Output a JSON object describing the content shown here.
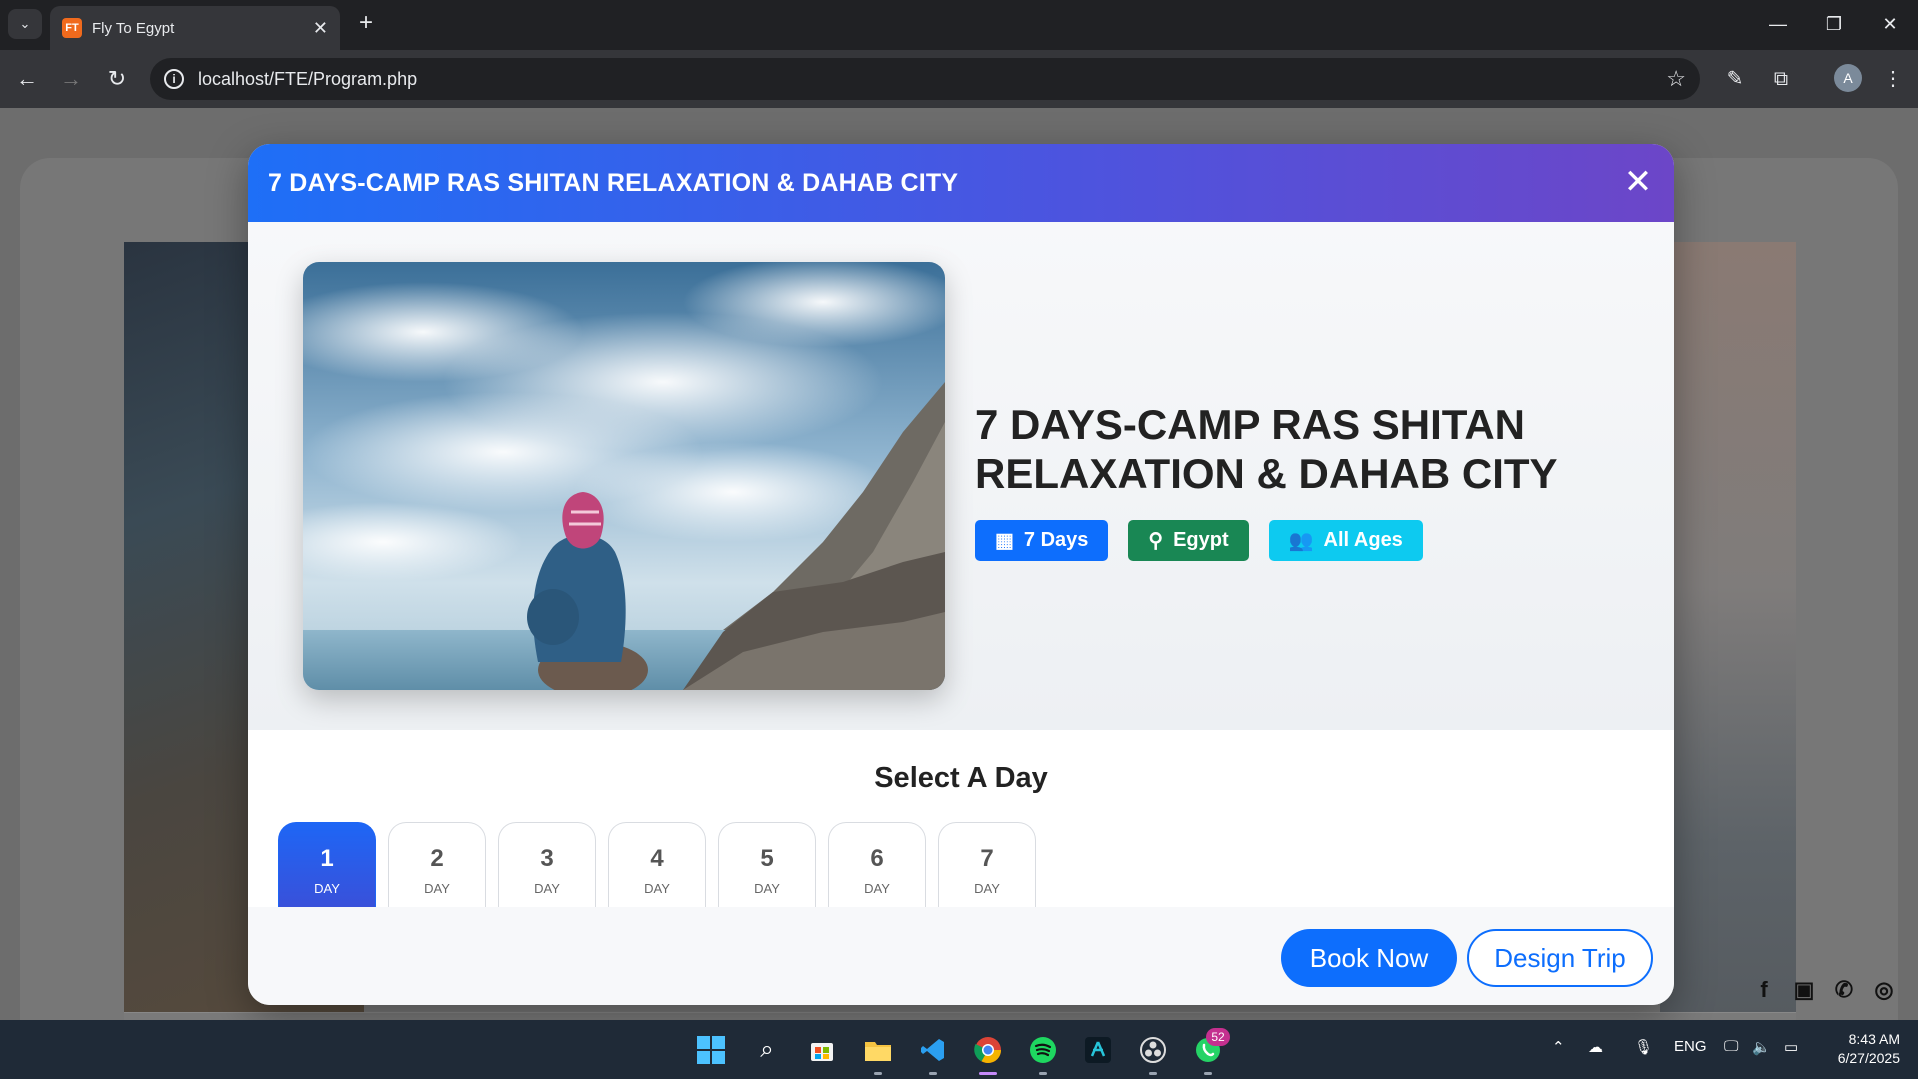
{
  "browser": {
    "tab_title": "Fly To Egypt",
    "favicon_text": "FT",
    "url": "localhost/FTE/Program.php",
    "profile_initial": "A"
  },
  "modal": {
    "header_title": "7 DAYS-CAMP RAS SHITAN RELAXATION & DAHAB CITY",
    "heading_line1": "7 DAYS-CAMP RAS SHITAN",
    "heading_line2": "RELAXATION & DAHAB CITY",
    "badges": {
      "days": "7 Days",
      "location": "Egypt",
      "ages": "All Ages"
    },
    "select_day_title": "Select A Day",
    "day_label": "DAY",
    "days": [
      "1",
      "2",
      "3",
      "4",
      "5",
      "6",
      "7"
    ],
    "active_day": "1",
    "book_button": "Book Now",
    "design_button": "Design Trip"
  },
  "taskbar": {
    "whatsapp_badge": "52",
    "language": "ENG",
    "time": "8:43 AM",
    "date": "6/27/2025"
  },
  "colors": {
    "primary": "#0d6efd",
    "success": "#198754",
    "info": "#0dcaf0",
    "header_gradient_start": "#1e6ff7",
    "header_gradient_end": "#6c46c8"
  }
}
